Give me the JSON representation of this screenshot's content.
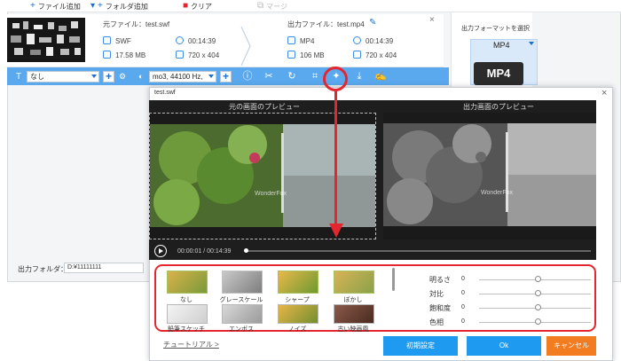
{
  "toolbar": {
    "add_file": "ファイル追加",
    "add_folder": "フォルダ追加",
    "clear": "クリア",
    "merge": "マージ"
  },
  "source": {
    "label": "元ファイル：",
    "file": "test.swf",
    "format": "SWF",
    "duration": "00:14:39",
    "size": "17.58 MB",
    "resolution": "720 x 404"
  },
  "output": {
    "label": "出力ファイル：",
    "file": "test.mp4",
    "format": "MP4",
    "duration": "00:14:39",
    "size": "106 MB",
    "resolution": "720 x 404"
  },
  "options": {
    "subtitle": "なし",
    "audio": "mo3, 44100 Hz,"
  },
  "format_panel": {
    "title": "出力フォーマットを選択",
    "selected": "MP4",
    "icon_text": "MP4"
  },
  "output_folder": {
    "label": "出力フォルダ：",
    "path": "D:¥11111111"
  },
  "dialog": {
    "title": "test.swf",
    "orig_label": "元の画面のプレビュー",
    "out_label": "出力画面のプレビュー",
    "timecode": "00:00:01 / 00:14:39",
    "watermark": "WonderFox",
    "filters": [
      "なし",
      "グレースケール",
      "シャープ",
      "ぼかし",
      "鉛筆スケッチ",
      "エンボス",
      "ノイズ",
      "古い映画風"
    ],
    "adjust": [
      {
        "label": "明るさ",
        "value": "0"
      },
      {
        "label": "対比",
        "value": "0"
      },
      {
        "label": "飽和度",
        "value": "0"
      },
      {
        "label": "色相",
        "value": "0"
      }
    ],
    "tutorial": "チュートリアル >",
    "reset": "初期設定",
    "ok": "Ok",
    "cancel": "キャンセル"
  },
  "colors": {
    "accent": "#5aa9ee",
    "highlight": "#e6262e",
    "ok": "#1e9bf0",
    "cancel": "#f47c20"
  }
}
